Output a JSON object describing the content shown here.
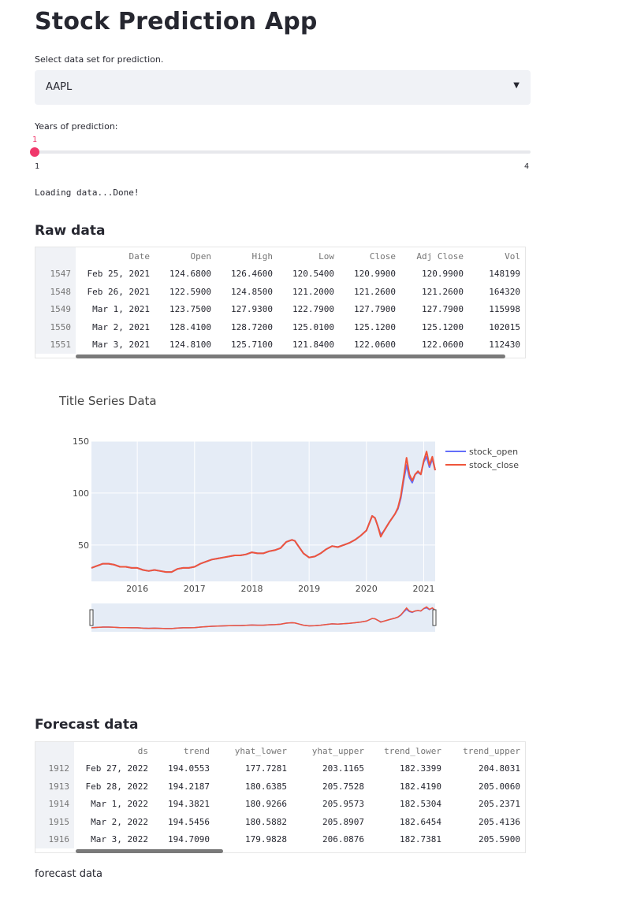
{
  "app": {
    "title": "Stock Prediction App",
    "select_label": "Select data set for prediction.",
    "selected_stock": "AAPL",
    "slider_label": "Years of prediction:",
    "slider_value": "1",
    "slider_min": "1",
    "slider_max": "4",
    "status": "Loading data...Done!"
  },
  "raw_data": {
    "heading": "Raw data",
    "columns": [
      "Date",
      "Open",
      "High",
      "Low",
      "Close",
      "Adj Close",
      "Vol"
    ],
    "rows": [
      {
        "index": "1547",
        "cells": [
          "Feb 25, 2021",
          "124.6800",
          "126.4600",
          "120.5400",
          "120.9900",
          "120.9900",
          "148199"
        ]
      },
      {
        "index": "1548",
        "cells": [
          "Feb 26, 2021",
          "122.5900",
          "124.8500",
          "121.2000",
          "121.2600",
          "121.2600",
          "164320"
        ]
      },
      {
        "index": "1549",
        "cells": [
          "Mar 1, 2021",
          "123.7500",
          "127.9300",
          "122.7900",
          "127.7900",
          "127.7900",
          "115998"
        ]
      },
      {
        "index": "1550",
        "cells": [
          "Mar 2, 2021",
          "128.4100",
          "128.7200",
          "125.0100",
          "125.1200",
          "125.1200",
          "102015"
        ]
      },
      {
        "index": "1551",
        "cells": [
          "Mar 3, 2021",
          "124.8100",
          "125.7100",
          "121.8400",
          "122.0600",
          "122.0600",
          "112430"
        ]
      }
    ]
  },
  "forecast": {
    "heading": "Forecast data",
    "columns": [
      "ds",
      "trend",
      "yhat_lower",
      "yhat_upper",
      "trend_lower",
      "trend_upper"
    ],
    "rows": [
      {
        "index": "1912",
        "cells": [
          "Feb 27, 2022",
          "194.0553",
          "177.7281",
          "203.1165",
          "182.3399",
          "204.8031"
        ]
      },
      {
        "index": "1913",
        "cells": [
          "Feb 28, 2022",
          "194.2187",
          "180.6385",
          "205.7528",
          "182.4190",
          "205.0060"
        ]
      },
      {
        "index": "1914",
        "cells": [
          "Mar 1, 2022",
          "194.3821",
          "180.9266",
          "205.9573",
          "182.5304",
          "205.2371"
        ]
      },
      {
        "index": "1915",
        "cells": [
          "Mar 2, 2022",
          "194.5456",
          "180.5882",
          "205.8907",
          "182.6454",
          "205.4136"
        ]
      },
      {
        "index": "1916",
        "cells": [
          "Mar 3, 2022",
          "194.7090",
          "179.9828",
          "206.0876",
          "182.7381",
          "205.5900"
        ]
      }
    ],
    "caption": "forecast data"
  },
  "chart_data": {
    "type": "line",
    "title": "Title Series Data",
    "xlabel": "",
    "ylabel": "",
    "x_ticks": [
      "2016",
      "2017",
      "2018",
      "2019",
      "2020",
      "2021"
    ],
    "y_ticks": [
      "50",
      "100",
      "150"
    ],
    "xlim": [
      2015.2,
      2021.2
    ],
    "ylim": [
      15,
      150
    ],
    "grid": true,
    "legend_position": "top-right",
    "range_slider": true,
    "series": [
      {
        "name": "stock_open",
        "color": "#636efa",
        "x": [
          2015.2,
          2015.3,
          2015.4,
          2015.5,
          2015.6,
          2015.7,
          2015.8,
          2015.9,
          2016.0,
          2016.1,
          2016.2,
          2016.3,
          2016.4,
          2016.5,
          2016.6,
          2016.7,
          2016.8,
          2016.9,
          2017.0,
          2017.1,
          2017.2,
          2017.3,
          2017.4,
          2017.5,
          2017.6,
          2017.7,
          2017.8,
          2017.9,
          2018.0,
          2018.1,
          2018.2,
          2018.3,
          2018.4,
          2018.5,
          2018.6,
          2018.7,
          2018.75,
          2018.8,
          2018.9,
          2019.0,
          2019.1,
          2019.2,
          2019.3,
          2019.4,
          2019.5,
          2019.6,
          2019.7,
          2019.8,
          2019.9,
          2020.0,
          2020.1,
          2020.15,
          2020.2,
          2020.25,
          2020.3,
          2020.4,
          2020.5,
          2020.55,
          2020.6,
          2020.65,
          2020.7,
          2020.75,
          2020.8,
          2020.85,
          2020.9,
          2020.95,
          2021.0,
          2021.05,
          2021.1,
          2021.15,
          2021.2
        ],
        "y": [
          28,
          30,
          32,
          32,
          31,
          29,
          29,
          28,
          28,
          26,
          25,
          26,
          25,
          24,
          24,
          27,
          28,
          28,
          29,
          32,
          34,
          36,
          37,
          38,
          39,
          40,
          40,
          41,
          43,
          42,
          42,
          44,
          45,
          47,
          53,
          55,
          54,
          50,
          42,
          38,
          39,
          42,
          46,
          49,
          48,
          50,
          52,
          55,
          59,
          64,
          78,
          76,
          68,
          60,
          63,
          72,
          80,
          85,
          95,
          112,
          127,
          115,
          110,
          118,
          120,
          118,
          130,
          135,
          125,
          133,
          122
        ]
      },
      {
        "name": "stock_close",
        "color": "#ef553b",
        "x": [
          2015.2,
          2015.3,
          2015.4,
          2015.5,
          2015.6,
          2015.7,
          2015.8,
          2015.9,
          2016.0,
          2016.1,
          2016.2,
          2016.3,
          2016.4,
          2016.5,
          2016.6,
          2016.7,
          2016.8,
          2016.9,
          2017.0,
          2017.1,
          2017.2,
          2017.3,
          2017.4,
          2017.5,
          2017.6,
          2017.7,
          2017.8,
          2017.9,
          2018.0,
          2018.1,
          2018.2,
          2018.3,
          2018.4,
          2018.5,
          2018.6,
          2018.7,
          2018.75,
          2018.8,
          2018.9,
          2019.0,
          2019.1,
          2019.2,
          2019.3,
          2019.4,
          2019.5,
          2019.6,
          2019.7,
          2019.8,
          2019.9,
          2020.0,
          2020.1,
          2020.15,
          2020.2,
          2020.25,
          2020.3,
          2020.4,
          2020.5,
          2020.55,
          2020.6,
          2020.65,
          2020.7,
          2020.75,
          2020.8,
          2020.85,
          2020.9,
          2020.95,
          2021.0,
          2021.05,
          2021.1,
          2021.15,
          2021.2
        ],
        "y": [
          28,
          30,
          32,
          32,
          31,
          29,
          29,
          28,
          28,
          26,
          25,
          26,
          25,
          24,
          24,
          27,
          28,
          28,
          29,
          32,
          34,
          36,
          37,
          38,
          39,
          40,
          40,
          41,
          43,
          42,
          42,
          44,
          45,
          47,
          53,
          55,
          54,
          50,
          42,
          38,
          39,
          42,
          46,
          49,
          48,
          50,
          52,
          55,
          59,
          64,
          78,
          76,
          68,
          58,
          63,
          72,
          80,
          86,
          97,
          115,
          134,
          118,
          112,
          118,
          121,
          118,
          131,
          140,
          127,
          135,
          122
        ]
      }
    ]
  }
}
